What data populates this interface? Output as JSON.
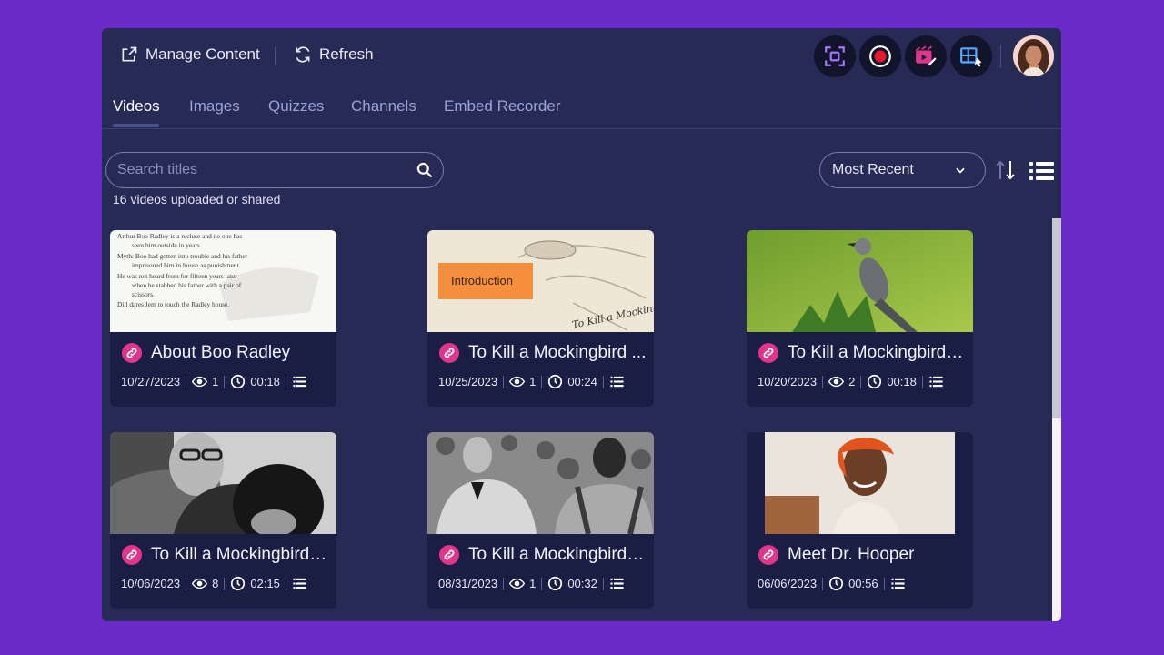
{
  "toolbar": {
    "manage_label": "Manage Content",
    "refresh_label": "Refresh"
  },
  "tabs": [
    {
      "label": "Videos",
      "active": true
    },
    {
      "label": "Images",
      "active": false
    },
    {
      "label": "Quizzes",
      "active": false
    },
    {
      "label": "Channels",
      "active": false
    },
    {
      "label": "Embed Recorder",
      "active": false
    }
  ],
  "search": {
    "placeholder": "Search titles",
    "value": ""
  },
  "count_text": "16 videos uploaded or shared",
  "sort": {
    "selected": "Most Recent"
  },
  "colors": {
    "background": "#6b2bc8",
    "panel": "#262a55",
    "card": "#1a1d44",
    "accent": "#e0368a",
    "record": "#e8192c"
  },
  "videos": [
    {
      "title": "About Boo Radley",
      "date": "10/27/2023",
      "views": "1",
      "duration": "00:18",
      "thumb_lines": [
        "Arthur Boo Radley is a recluse and no one has",
        "seen him outside in years",
        "Myth: Boo had gotten into trouble and his father",
        "imprisoned him in house as punishment.",
        "He was not heard from for fifteen years later",
        "when he stabbed his father with a pair of",
        "scissors.",
        "Dill dares Jem to touch the Radley house."
      ]
    },
    {
      "title": "To Kill a Mockingbird ...",
      "date": "10/25/2023",
      "views": "1",
      "duration": "00:24",
      "thumb_label": "Introduction",
      "thumb_script": "To Kill a Mockingbird by"
    },
    {
      "title": "To Kill a Mockingbird: ...",
      "date": "10/20/2023",
      "views": "2",
      "duration": "00:18"
    },
    {
      "title": "To Kill a Mockingbird: ...",
      "date": "10/06/2023",
      "views": "8",
      "duration": "02:15"
    },
    {
      "title": "To Kill a Mockingbird: ...",
      "date": "08/31/2023",
      "views": "1",
      "duration": "00:32"
    },
    {
      "title": "Meet Dr. Hooper",
      "date": "06/06/2023",
      "views": null,
      "duration": "00:56"
    }
  ]
}
